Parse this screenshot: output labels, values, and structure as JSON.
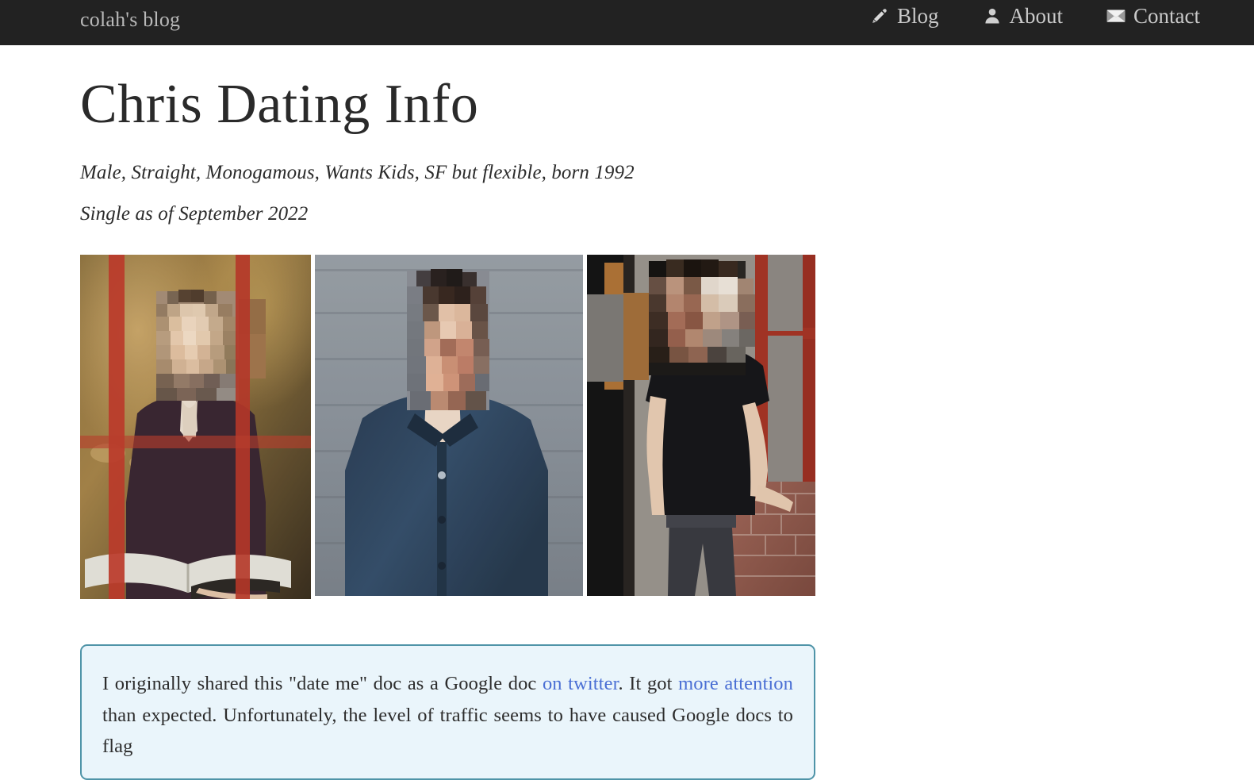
{
  "header": {
    "brand": "colah's blog",
    "nav": [
      {
        "label": "Blog",
        "icon": "pencil-icon"
      },
      {
        "label": "About",
        "icon": "person-icon"
      },
      {
        "label": "Contact",
        "icon": "envelope-icon"
      }
    ]
  },
  "main": {
    "title": "Chris Dating Info",
    "sublines": [
      "Male, Straight, Monogamous, Wants Kids, SF but flexible, born 1992",
      "Single as of September 2022"
    ],
    "photos": [
      {
        "alt": "Person in dark purple shirt reading a book behind a red window frame",
        "caption": ""
      },
      {
        "alt": "Person in navy denim shirt standing in front of gray siding",
        "caption": ""
      },
      {
        "alt": "Person in black t-shirt and dark jeans leaning on a brick wall",
        "caption": ""
      }
    ],
    "callout": {
      "text_1": "I originally shared this \"date me\" doc as a Google doc ",
      "link_1": "on twitter",
      "text_2": ". It got ",
      "link_2": "more attention",
      "text_3": " than expected. Unfortunately, the level of traffic seems to have caused Google docs to flag"
    }
  },
  "colors": {
    "header_bg": "#222222",
    "brand_text": "#b9b9b9",
    "nav_text": "#c9c9c9",
    "title_text": "#2a2a2a",
    "callout_bg": "#eaf5fb",
    "callout_border": "#4f94a8",
    "link": "#4a6fd4"
  }
}
